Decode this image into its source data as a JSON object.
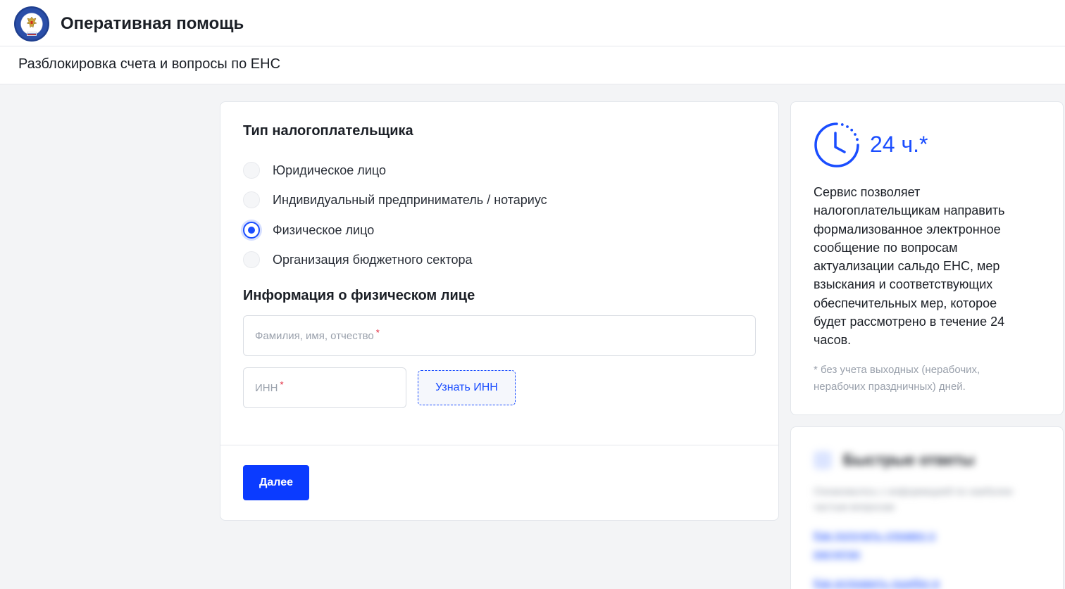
{
  "header": {
    "app_title": "Оперативная помощь"
  },
  "page": {
    "title": "Разблокировка счета и вопросы по ЕНС"
  },
  "form": {
    "taxpayer_type_title": "Тип налогоплательщика",
    "taxpayer_types": [
      {
        "label": "Юридическое лицо",
        "checked": false
      },
      {
        "label": "Индивидуальный предприниматель / нотариус",
        "checked": false
      },
      {
        "label": "Физическое лицо",
        "checked": true
      },
      {
        "label": "Организация бюджетного сектора",
        "checked": false
      }
    ],
    "person_info_title": "Информация о физическом лице",
    "fio_placeholder": "Фамилия, имя, отчество",
    "inn_placeholder": "ИНН",
    "required_mark": "*",
    "find_inn_label": "Узнать ИНН",
    "next_label": "Далее"
  },
  "info": {
    "time": "24 ч.*",
    "description": "Сервис позволяет налогоплательщикам направить формализованное электронное сообщение по вопросам актуализации сальдо ЕНС, мер взыскания и соответствующих обеспечительных мер, которое будет рассмотрено в течение 24 часов.",
    "note": "* без учета выходных (нерабочих, нерабочих праздничных) дней."
  },
  "quick_answers": {
    "title": "Быстрые ответы",
    "description": "Ознакомьтесь с информацией по наиболее частым вопросам",
    "links": [
      "Как получить справку о расчетах",
      "Как исправить ошибку в декларации"
    ]
  },
  "colors": {
    "accent": "#1a4dff",
    "primary_button": "#0b3bff",
    "required": "#e0253a",
    "background": "#f3f4f6"
  }
}
